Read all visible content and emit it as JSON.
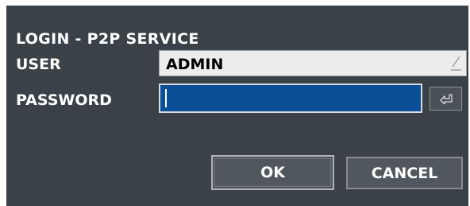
{
  "dialog": {
    "title": "LOGIN - P2P SERVICE",
    "user_label": "USER",
    "user_value": "ADMIN",
    "password_label": "PASSWORD",
    "password_value": "",
    "ok_label": "OK",
    "cancel_label": "CANCEL"
  },
  "icons": {
    "user_dropdown": "corner-edit-icon",
    "password_enter": "enter-return-icon"
  },
  "colors": {
    "dialog_bg": "#3a4147",
    "password_field_bg": "#0b4f99"
  }
}
